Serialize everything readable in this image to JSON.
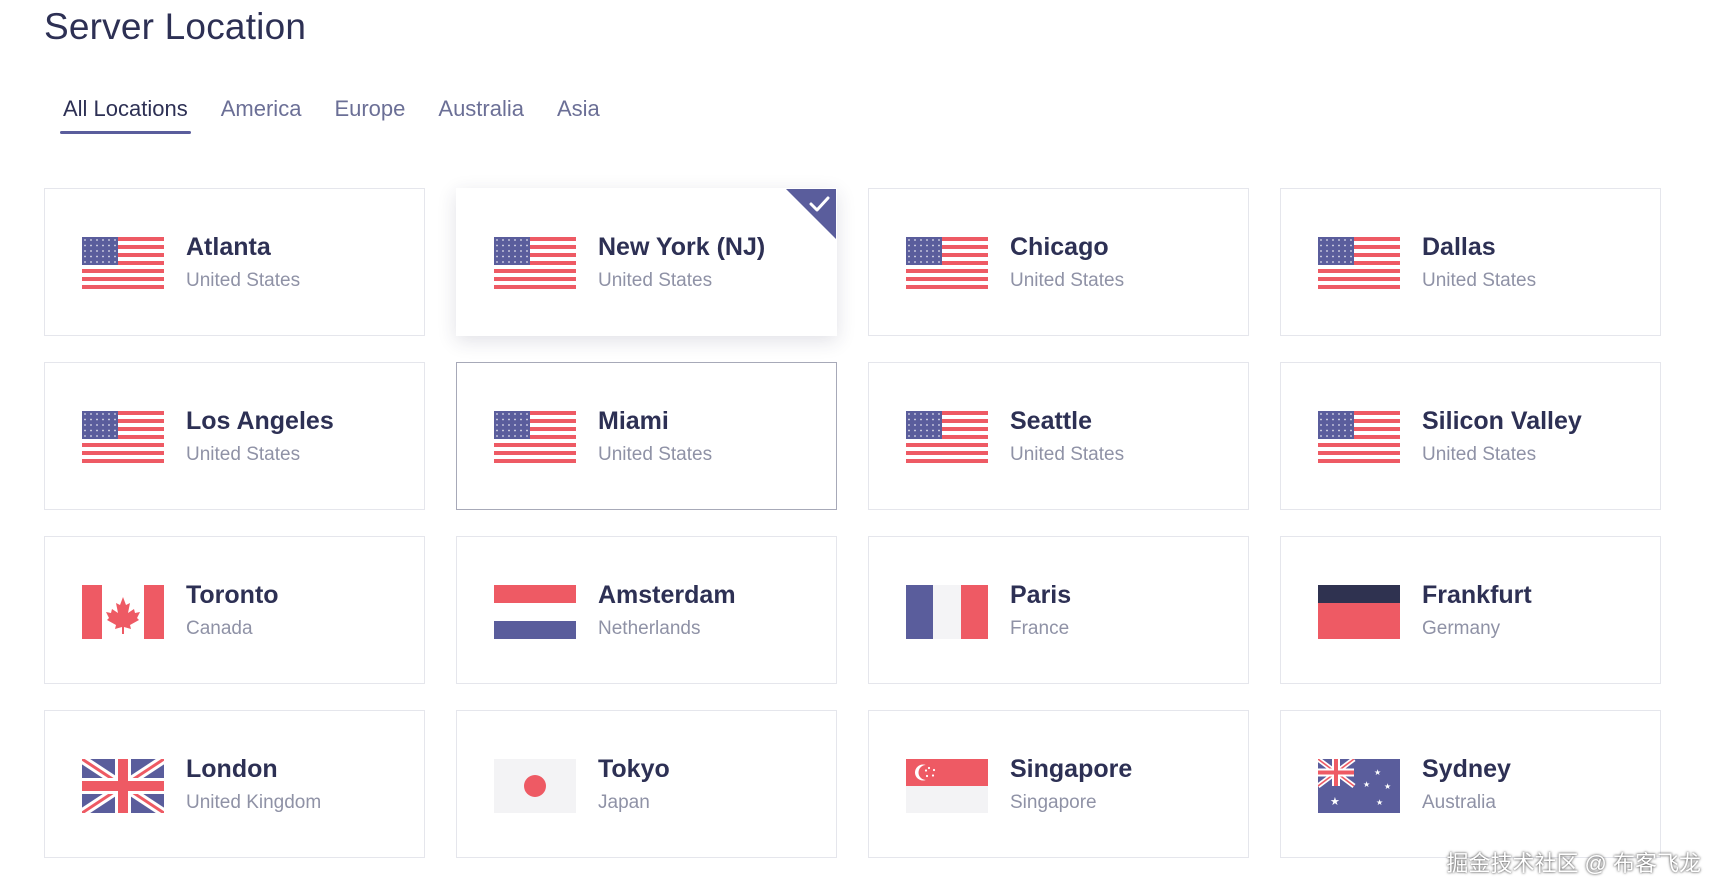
{
  "page": {
    "title": "Server Location"
  },
  "tabs": [
    {
      "label": "All Locations",
      "active": true
    },
    {
      "label": "America",
      "active": false
    },
    {
      "label": "Europe",
      "active": false
    },
    {
      "label": "Australia",
      "active": false
    },
    {
      "label": "Asia",
      "active": false
    }
  ],
  "locations": [
    {
      "city": "Atlanta",
      "country": "United States",
      "flag": "us-flag-icon"
    },
    {
      "city": "New York (NJ)",
      "country": "United States",
      "flag": "us-flag-icon",
      "selected": true
    },
    {
      "city": "Chicago",
      "country": "United States",
      "flag": "us-flag-icon"
    },
    {
      "city": "Dallas",
      "country": "United States",
      "flag": "us-flag-icon"
    },
    {
      "city": "Los Angeles",
      "country": "United States",
      "flag": "us-flag-icon"
    },
    {
      "city": "Miami",
      "country": "United States",
      "flag": "us-flag-icon",
      "hovered": true
    },
    {
      "city": "Seattle",
      "country": "United States",
      "flag": "us-flag-icon"
    },
    {
      "city": "Silicon Valley",
      "country": "United States",
      "flag": "us-flag-icon"
    },
    {
      "city": "Toronto",
      "country": "Canada",
      "flag": "canada-flag-icon"
    },
    {
      "city": "Amsterdam",
      "country": "Netherlands",
      "flag": "netherlands-flag-icon"
    },
    {
      "city": "Paris",
      "country": "France",
      "flag": "france-flag-icon"
    },
    {
      "city": "Frankfurt",
      "country": "Germany",
      "flag": "germany-flag-icon"
    },
    {
      "city": "London",
      "country": "United Kingdom",
      "flag": "uk-flag-icon"
    },
    {
      "city": "Tokyo",
      "country": "Japan",
      "flag": "japan-flag-icon"
    },
    {
      "city": "Singapore",
      "country": "Singapore",
      "flag": "singapore-flag-icon"
    },
    {
      "city": "Sydney",
      "country": "Australia",
      "flag": "australia-flag-icon"
    }
  ],
  "watermark": "掘金技术社区 @ 布客飞龙",
  "colors": {
    "text_primary": "#2d3054",
    "text_muted": "#8f92a6",
    "accent": "#5a5d9c",
    "flag_red": "#ee5a64",
    "flag_blue": "#5a5d9c"
  }
}
